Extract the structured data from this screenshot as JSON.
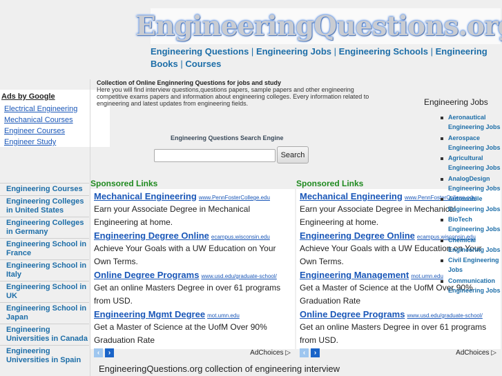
{
  "header": {
    "logo_text": "EngineeringQuestions.org",
    "nav": [
      {
        "label": "Engineering Questions"
      },
      {
        "label": "Engineering Jobs"
      },
      {
        "label": "Engineering Schools"
      },
      {
        "label": "Engineering Books"
      },
      {
        "label": "Courses"
      }
    ],
    "nav_separator": "|"
  },
  "ads_by_google": {
    "title": "Ads by Google",
    "links": [
      "Electrical Engineering",
      "Mechanical Courses",
      "Engineer Courses",
      "Engineer Study"
    ]
  },
  "intro": {
    "heading": "Collection of Online Enginnering Questions for jobs and study",
    "text": "Here you will find interview questions,questions papers, sample papers and other engineering competitive exams papers and information about engineering colleges. Every information related to engineering and latest updates from engineering fields."
  },
  "search": {
    "title": "Engineering Questions Search Engine",
    "input_value": "",
    "input_placeholder": "",
    "button_label": "Search"
  },
  "left_nav": [
    "Engineering Courses",
    "Engineering Colleges in United States",
    "Engineering Colleges in Germany",
    "Engineering School in France",
    "Engineering School in Italy",
    "Engineering School in UK",
    "Engineering School in Japan",
    "Engineering Universities in Canada",
    "Engineering Universities in Spain"
  ],
  "ad_blocks": [
    {
      "heading": "Sponsored Links",
      "ads": [
        {
          "title": "Mechanical Engineering",
          "url": "www.PennFosterCollege.edu",
          "desc": "Earn your Associate Degree in Mechanical Engineering at home."
        },
        {
          "title": "Engineering Degree Online",
          "url": "ecampus.wisconsin.edu",
          "desc": "Achieve Your Goals with a UW Education on Your Own Terms."
        },
        {
          "title": "Online Degree Programs",
          "url": "www.usd.edu/graduate-school/",
          "desc": "Get an online Masters Degree in over 61 programs from USD."
        },
        {
          "title": "Engineering Mgmt Degree",
          "url": "mot.umn.edu",
          "desc": "Get a Master of Science at the UofM Over 90% Graduation Rate"
        }
      ],
      "prev_icon": "‹",
      "next_icon": "›",
      "adchoices": "AdChoices ▷"
    },
    {
      "heading": "Sponsored Links",
      "ads": [
        {
          "title": "Mechanical Engineering",
          "url": "www.PennFosterCollege.edu",
          "desc": "Earn your Associate Degree in Mechanical Engineering at home."
        },
        {
          "title": "Engineering Degree Online",
          "url": "ecampus.wisconsin.edu",
          "desc": "Achieve Your Goals with a UW Education on Your Own Terms."
        },
        {
          "title": "Engineering Management",
          "url": "mot.umn.edu",
          "desc": "Get a Master of Science at the UofM Over 90% Graduation Rate"
        },
        {
          "title": "Online Degree Programs",
          "url": "www.usd.edu/graduate-school/",
          "desc": "Get an online Masters Degree in over 61 programs from USD."
        }
      ],
      "prev_icon": "‹",
      "next_icon": "›",
      "adchoices": "AdChoices ▷"
    }
  ],
  "bottom_text": "EngineeringQuestions.org collection of engineering interview",
  "jobs": {
    "title": "Engineering Jobs",
    "items": [
      "Aeronautical Engineering Jobs",
      "Aerospace Engineering Jobs",
      "Agricultural Engineering Jobs",
      "AnalogDesign Engineering Jobs",
      "Automobile Engineering Jobs",
      "BioTech Engineering Jobs",
      "Chemical Engineering Jobs",
      "Civil Engineering Jobs",
      "Communication Engineering Jobs"
    ]
  },
  "colors": {
    "link_blue": "#1d6ea8",
    "ad_link_blue": "#1a57b8",
    "sponsored_green": "#1f8a1f",
    "page_bg": "#efefef"
  }
}
